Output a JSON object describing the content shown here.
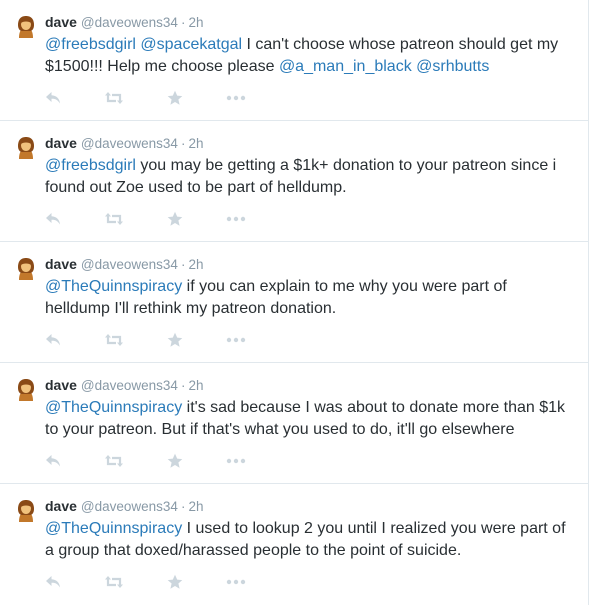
{
  "colors": {
    "mention": "#2b7bb9",
    "meta": "#8899a6",
    "action_icon": "#ccd6dd",
    "divider": "#e1e8ed"
  },
  "tweets": [
    {
      "name": "dave",
      "handle": "@daveowens34",
      "separator": "·",
      "time": "2h",
      "segments": [
        {
          "m": "@freebsdgirl"
        },
        {
          "t": " "
        },
        {
          "m": "@spacekatgal"
        },
        {
          "t": " I can't choose whose patreon should get my $1500!!!  Help me choose please "
        },
        {
          "m": "@a_man_in_black"
        },
        {
          "t": " "
        },
        {
          "m": "@srhbutts"
        }
      ]
    },
    {
      "name": "dave",
      "handle": "@daveowens34",
      "separator": "·",
      "time": "2h",
      "segments": [
        {
          "m": "@freebsdgirl"
        },
        {
          "t": " you may be getting a $1k+ donation to your patreon since i found out Zoe used to be part of helldump."
        }
      ]
    },
    {
      "name": "dave",
      "handle": "@daveowens34",
      "separator": "·",
      "time": "2h",
      "segments": [
        {
          "m": "@TheQuinnspiracy"
        },
        {
          "t": " if you can explain to me why you were part of helldump I'll rethink my patreon donation."
        }
      ]
    },
    {
      "name": "dave",
      "handle": "@daveowens34",
      "separator": "·",
      "time": "2h",
      "segments": [
        {
          "m": "@TheQuinnspiracy"
        },
        {
          "t": " it's sad because I was about to donate more than $1k to your patreon. But if that's what you used to do, it'll go elsewhere"
        }
      ]
    },
    {
      "name": "dave",
      "handle": "@daveowens34",
      "separator": "·",
      "time": "2h",
      "segments": [
        {
          "m": "@TheQuinnspiracy"
        },
        {
          "t": " I used to lookup 2 you until I realized you were part of a group that doxed/harassed people to the point of suicide."
        }
      ]
    }
  ],
  "actions": [
    {
      "name": "reply-icon"
    },
    {
      "name": "retweet-icon"
    },
    {
      "name": "favorite-icon"
    },
    {
      "name": "more-icon"
    }
  ]
}
